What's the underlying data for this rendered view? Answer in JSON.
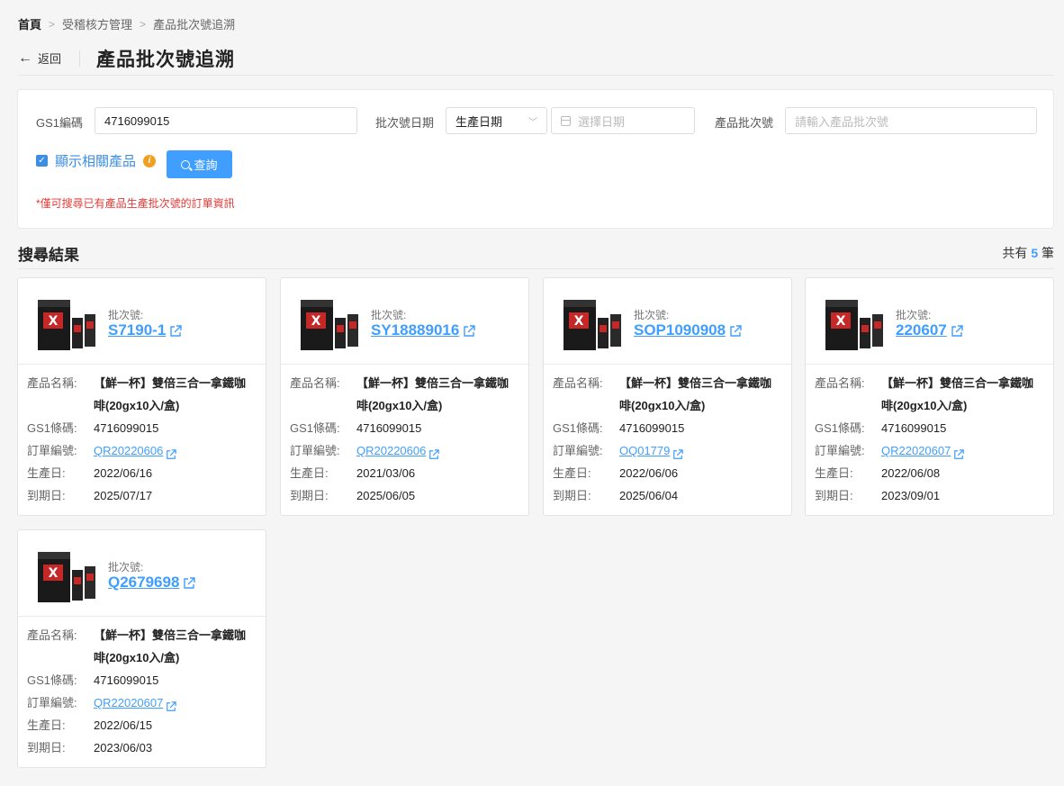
{
  "breadcrumb": {
    "home": "首頁",
    "level2": "受稽核方管理",
    "current": "產品批次號追溯",
    "sep": ">"
  },
  "header": {
    "back_label": "返回",
    "title": "產品批次號追溯"
  },
  "search": {
    "gs1_label": "GS1編碼",
    "gs1_value": "4716099015",
    "date_label": "批次號日期",
    "date_type_value": "生產日期",
    "date_placeholder": "選擇日期",
    "batch_label": "產品批次號",
    "batch_placeholder": "請輸入產品批次號",
    "show_related_label": "顯示相關產品",
    "show_related_checked": true,
    "query_label": "查詢",
    "note": "*僅可搜尋已有產品生產批次號的訂單資訊"
  },
  "results": {
    "title": "搜尋結果",
    "count_prefix": "共有",
    "count": "5",
    "count_suffix": "筆",
    "labels": {
      "batch": "批次號:",
      "name": "產品名稱:",
      "gs1": "GS1條碼:",
      "order": "訂單編號:",
      "mfg": "生產日:",
      "exp": "到期日:"
    },
    "cards": [
      {
        "batch": "S7190-1",
        "name_line1": "【鮮一杯】雙倍三合一拿鐵咖",
        "name_line2": "啡(20gx10入/盒)",
        "gs1": "4716099015",
        "order": "QR20220606",
        "mfg": "2022/06/16",
        "exp": "2025/07/17"
      },
      {
        "batch": "SY18889016",
        "name_line1": "【鮮一杯】雙倍三合一拿鐵咖",
        "name_line2": "啡(20gx10入/盒)",
        "gs1": "4716099015",
        "order": "QR20220606",
        "mfg": "2021/03/06",
        "exp": "2025/06/05"
      },
      {
        "batch": "SOP1090908",
        "name_line1": "【鮮一杯】雙倍三合一拿鐵咖",
        "name_line2": "啡(20gx10入/盒)",
        "gs1": "4716099015",
        "order": "OQ01779",
        "mfg": "2022/06/06",
        "exp": "2025/06/04"
      },
      {
        "batch": "220607",
        "name_line1": "【鮮一杯】雙倍三合一拿鐵咖",
        "name_line2": "啡(20gx10入/盒)",
        "gs1": "4716099015",
        "order": "QR22020607",
        "mfg": "2022/06/08",
        "exp": "2023/09/01"
      },
      {
        "batch": "Q2679698",
        "name_line1": "【鮮一杯】雙倍三合一拿鐵咖",
        "name_line2": "啡(20gx10入/盒)",
        "gs1": "4716099015",
        "order": "QR22020607",
        "mfg": "2022/06/15",
        "exp": "2023/06/03"
      }
    ]
  },
  "colors": {
    "accent": "#409eff",
    "warning": "#e53935",
    "info": "#f0a020"
  }
}
